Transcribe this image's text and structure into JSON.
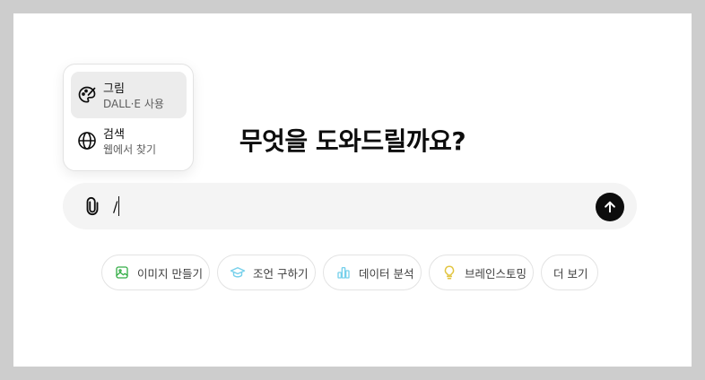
{
  "main": {
    "headline": "무엇을 도와드릴까요?"
  },
  "composer": {
    "input_value": "/",
    "attach_icon": "paperclip-icon",
    "send_icon": "arrow-up-icon"
  },
  "tool_menu": {
    "items": [
      {
        "title": "그림",
        "subtitle": "DALL·E 사용",
        "icon": "palette-icon",
        "active": true
      },
      {
        "title": "검색",
        "subtitle": "웹에서 찾기",
        "icon": "globe-icon",
        "active": false
      }
    ]
  },
  "suggestions": [
    {
      "label": "이미지 만들기",
      "icon": "image-icon",
      "color": "#35ae47"
    },
    {
      "label": "조언 구하기",
      "icon": "graduation-cap-icon",
      "color": "#76d0eb"
    },
    {
      "label": "데이터 분석",
      "icon": "bar-chart-icon",
      "color": "#76d0eb"
    },
    {
      "label": "브레인스토밍",
      "icon": "lightbulb-icon",
      "color": "#e2c541"
    },
    {
      "label": "더 보기",
      "icon": "",
      "color": ""
    }
  ]
}
